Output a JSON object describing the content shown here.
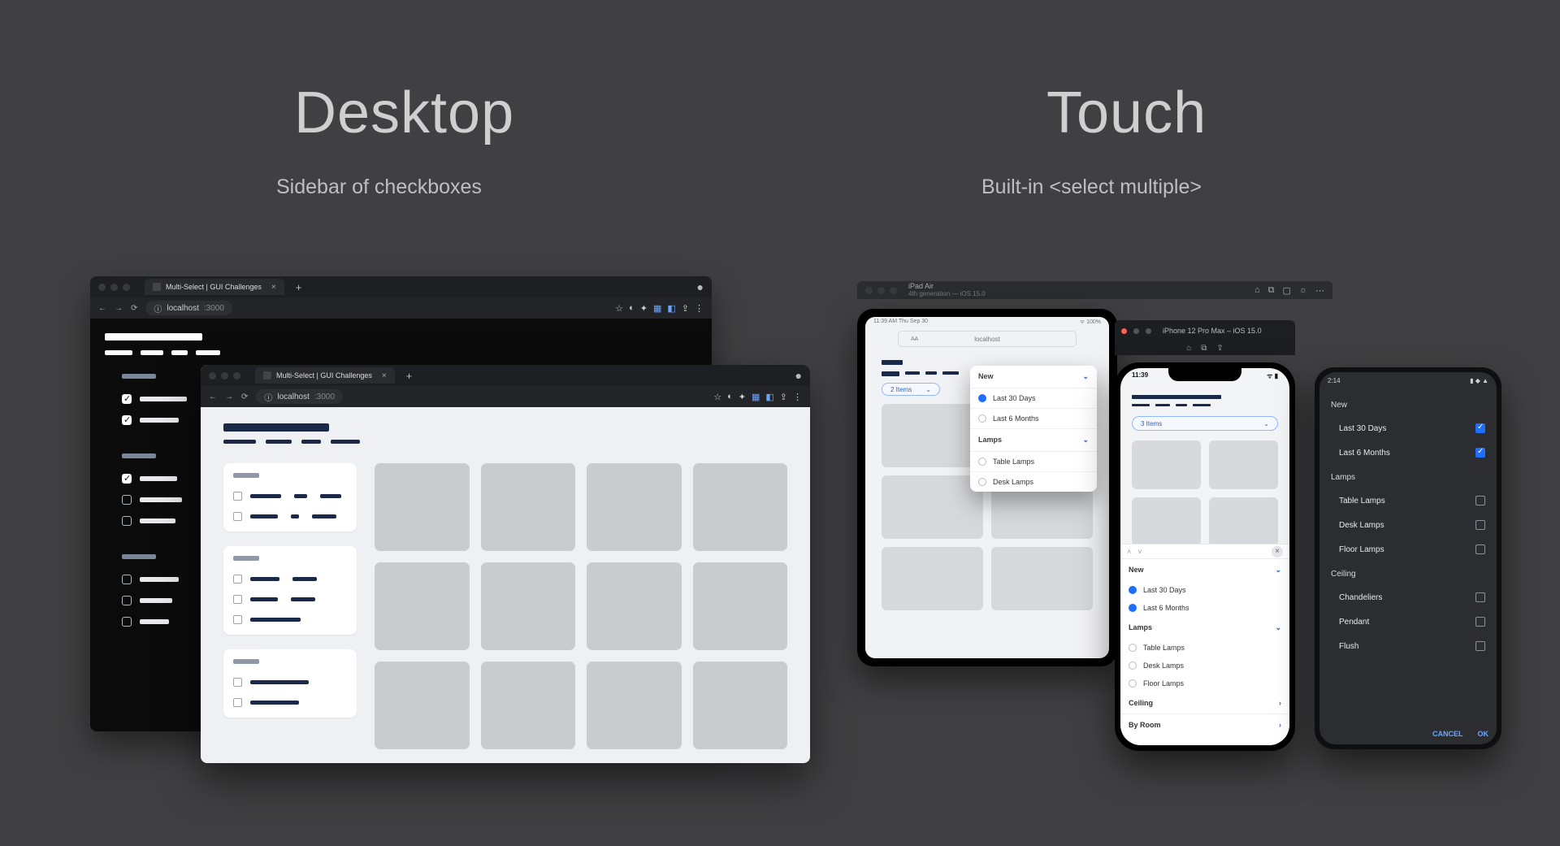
{
  "columns": {
    "desktop": {
      "title": "Desktop",
      "subtitle": "Sidebar of checkboxes"
    },
    "touch": {
      "title": "Touch",
      "subtitle": "Built-in <select multiple>"
    }
  },
  "browser_tab": {
    "title": "Multi-Select | GUI Challenges",
    "url": "localhost:3000",
    "url_host": "localhost",
    "url_port": ":3000"
  },
  "ipad": {
    "window": {
      "device": "iPad Air",
      "meta": "4th generation — iOS 15.0"
    },
    "status_left": "11:39 AM   Thu Sep 30",
    "url_center": "localhost",
    "url_aa": "AA",
    "pill": {
      "label": "2 Items",
      "arrow": "⌄"
    },
    "popover": {
      "sections": [
        {
          "title": "New",
          "items": [
            {
              "label": "Last 30 Days",
              "selected": true
            },
            {
              "label": "Last 6 Months",
              "selected": false
            }
          ]
        },
        {
          "title": "Lamps",
          "items": [
            {
              "label": "Table Lamps",
              "selected": false
            },
            {
              "label": "Desk Lamps",
              "selected": false
            }
          ]
        }
      ]
    }
  },
  "iphone": {
    "titlebar": "iPhone 12 Pro Max – iOS 15.0",
    "status_time": "11:39",
    "pill": {
      "label": "3 Items",
      "arrow": "⌄"
    },
    "sheet": {
      "sections": [
        {
          "title": "New",
          "expanded": true,
          "items": [
            {
              "label": "Last 30 Days",
              "selected": true
            },
            {
              "label": "Last 6 Months",
              "selected": true
            }
          ]
        },
        {
          "title": "Lamps",
          "expanded": true,
          "items": [
            {
              "label": "Table Lamps",
              "selected": false
            },
            {
              "label": "Desk Lamps",
              "selected": false
            },
            {
              "label": "Floor Lamps",
              "selected": false
            }
          ]
        },
        {
          "title": "Ceiling",
          "expanded": false
        },
        {
          "title": "By Room",
          "expanded": false
        }
      ]
    }
  },
  "android": {
    "status_time": "2:14",
    "groups": [
      {
        "title": "New",
        "items": [
          {
            "label": "Last 30 Days",
            "checked": true
          },
          {
            "label": "Last 6 Months",
            "checked": true
          }
        ]
      },
      {
        "title": "Lamps",
        "items": [
          {
            "label": "Table Lamps",
            "checked": false
          },
          {
            "label": "Desk Lamps",
            "checked": false
          },
          {
            "label": "Floor Lamps",
            "checked": false
          }
        ]
      },
      {
        "title": "Ceiling",
        "items": [
          {
            "label": "Chandeliers",
            "checked": false
          },
          {
            "label": "Pendant",
            "checked": false
          },
          {
            "label": "Flush",
            "checked": false
          }
        ]
      }
    ],
    "actions": {
      "cancel": "CANCEL",
      "ok": "OK"
    }
  }
}
